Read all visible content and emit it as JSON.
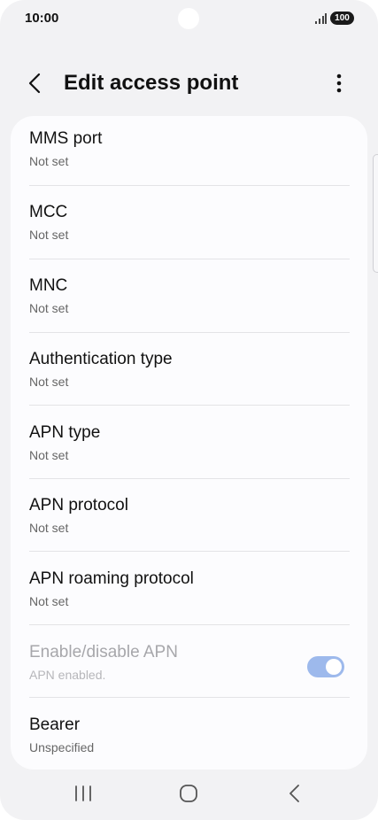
{
  "status_bar": {
    "time": "10:00",
    "battery": "100",
    "signal_icon": "signal-bars-icon"
  },
  "header": {
    "title": "Edit access point",
    "back_icon": "chevron-left-icon",
    "more_icon": "more-vertical-icon"
  },
  "settings": [
    {
      "title": "MMS port",
      "value": "Not set"
    },
    {
      "title": "MCC",
      "value": "Not set"
    },
    {
      "title": "MNC",
      "value": "Not set"
    },
    {
      "title": "Authentication type",
      "value": "Not set"
    },
    {
      "title": "APN type",
      "value": "Not set"
    },
    {
      "title": "APN protocol",
      "value": "Not set"
    },
    {
      "title": "APN roaming protocol",
      "value": "Not set"
    },
    {
      "title": "Enable/disable APN",
      "value": "APN enabled.",
      "toggle_on": true,
      "disabled": true
    },
    {
      "title": "Bearer",
      "value": "Unspecified"
    }
  ],
  "nav_bar": {
    "recents_icon": "recents-icon",
    "home_icon": "home-icon",
    "back_icon": "nav-back-icon"
  },
  "colors": {
    "background": "#f2f2f4",
    "card": "#fcfcfe",
    "toggle_track": "#9db9ec",
    "primary_text": "#111111",
    "secondary_text": "#666666"
  }
}
